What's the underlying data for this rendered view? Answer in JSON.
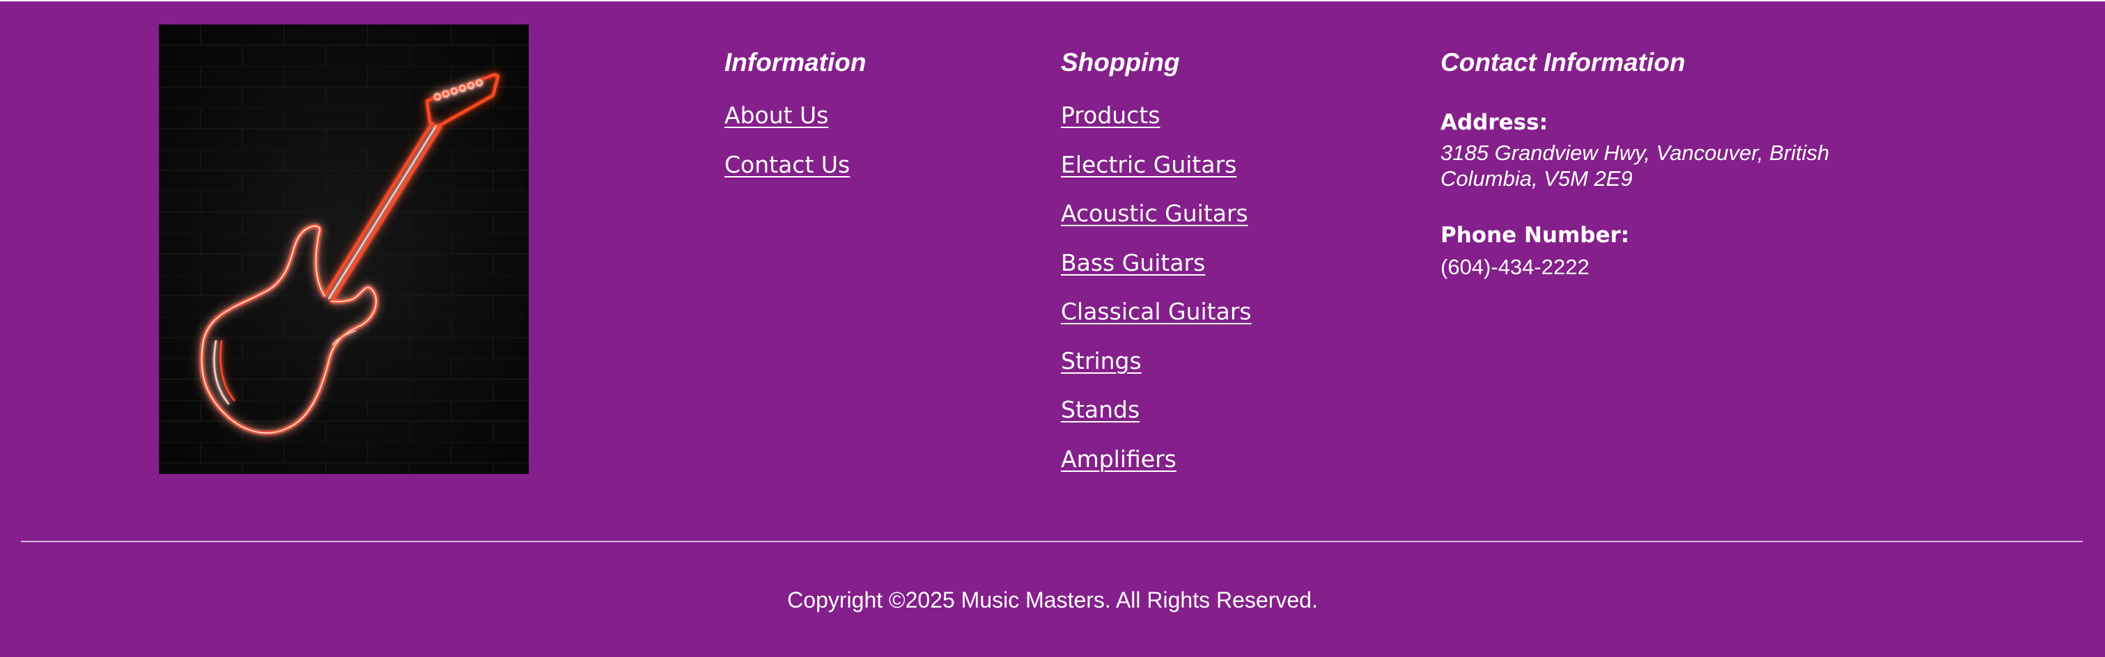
{
  "logo": {
    "alt": "Neon electric guitar sign",
    "icon": "neon-guitar-icon",
    "colors": {
      "background": "#0c0c0c",
      "neon_glow": "#ff3a1a",
      "neon_core": "#ffd9cf"
    }
  },
  "footer": {
    "background_color": "#841f8b",
    "text_color": "#ffffff",
    "information": {
      "heading": "Information",
      "links": [
        "About Us",
        "Contact Us"
      ]
    },
    "shopping": {
      "heading": "Shopping",
      "links": [
        "Products",
        "Electric Guitars",
        "Acoustic Guitars",
        "Bass Guitars",
        "Classical Guitars",
        "Strings",
        "Stands",
        "Amplifiers"
      ]
    },
    "contact": {
      "heading": "Contact Information",
      "address_label": "Address:",
      "address": "3185 Grandview Hwy, Vancouver, British Columbia, V5M 2E9",
      "phone_label": "Phone Number:",
      "phone": "(604)-434-2222"
    },
    "copyright": "Copyright ©2025 Music Masters. All Rights Reserved."
  }
}
